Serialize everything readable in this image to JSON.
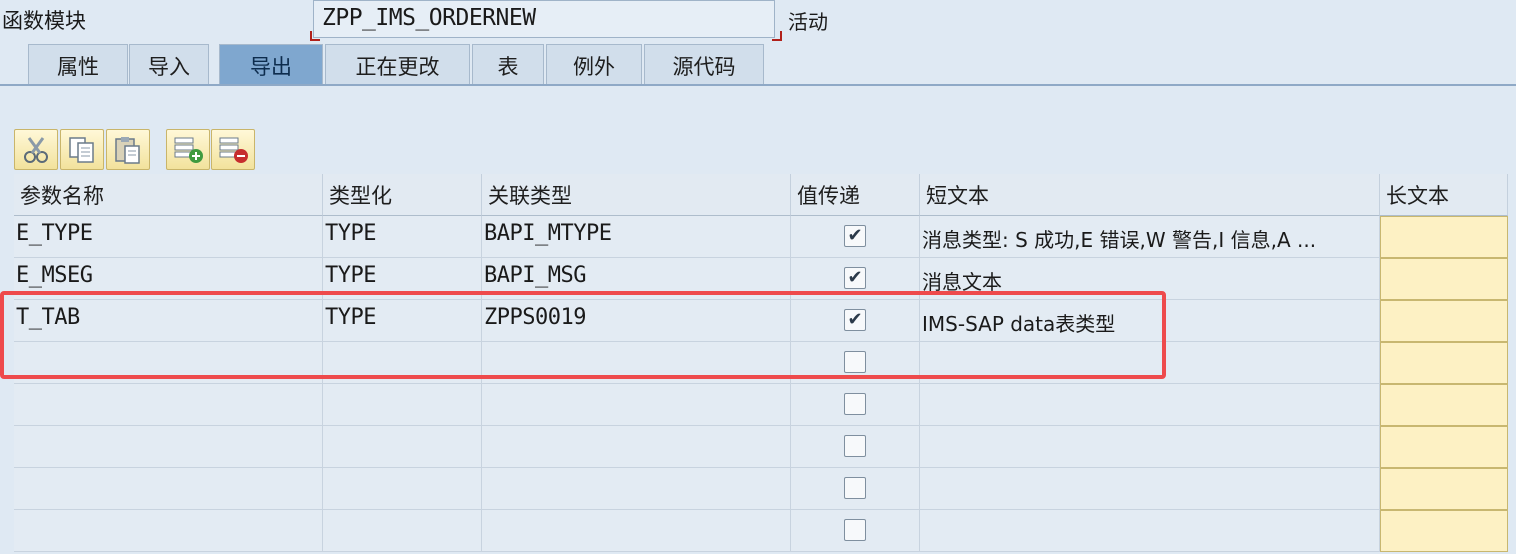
{
  "header": {
    "function_module_label": "函数模块",
    "function_module_value": "ZPP_IMS_ORDERNEW",
    "status": "活动"
  },
  "tabs": [
    {
      "label": "属性"
    },
    {
      "label": "导入"
    },
    {
      "label": "导出",
      "active": true
    },
    {
      "label": "正在更改"
    },
    {
      "label": "表"
    },
    {
      "label": "例外"
    },
    {
      "label": "源代码"
    }
  ],
  "toolbar": [
    "cut-icon",
    "copy-icon",
    "paste-icon",
    "insert-row-icon",
    "delete-row-icon"
  ],
  "table": {
    "columns": [
      "参数名称",
      "类型化",
      "关联类型",
      "值传递",
      "短文本",
      "长文本"
    ],
    "rows": [
      {
        "param": "E_TYPE",
        "typing": "TYPE",
        "ref_type": "BAPI_MTYPE",
        "pass_value": true,
        "short_text": "消息类型: S 成功,E 错误,W 警告,I 信息,A ..."
      },
      {
        "param": "E_MSEG",
        "typing": "TYPE",
        "ref_type": "BAPI_MSG",
        "pass_value": true,
        "short_text": "消息文本"
      },
      {
        "param": "T_TAB",
        "typing": "TYPE",
        "ref_type": "ZPPS0019",
        "pass_value": true,
        "short_text": "IMS-SAP data表类型"
      },
      {
        "param": "",
        "typing": "",
        "ref_type": "",
        "pass_value": false,
        "short_text": ""
      },
      {
        "param": "",
        "typing": "",
        "ref_type": "",
        "pass_value": false,
        "short_text": ""
      },
      {
        "param": "",
        "typing": "",
        "ref_type": "",
        "pass_value": false,
        "short_text": ""
      },
      {
        "param": "",
        "typing": "",
        "ref_type": "",
        "pass_value": false,
        "short_text": ""
      },
      {
        "param": "",
        "typing": "",
        "ref_type": "",
        "pass_value": false,
        "short_text": ""
      }
    ]
  },
  "colors": {
    "highlight": "#ee4a4c",
    "active_tab": "#7fa7cf",
    "long_text_cell": "#fdf1c4"
  }
}
